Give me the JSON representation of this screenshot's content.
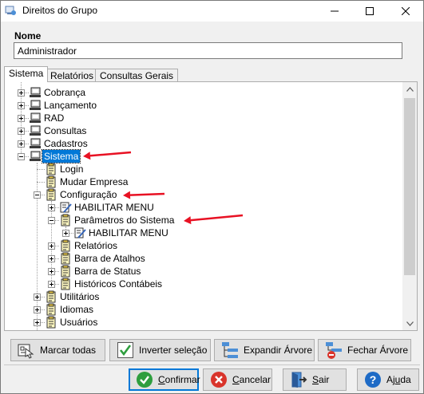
{
  "window": {
    "title": "Direitos do Grupo",
    "app_icon": "group-rights-icon",
    "minimize_icon": "minimize-icon",
    "maximize_icon": "maximize-icon",
    "close_icon": "close-icon"
  },
  "form": {
    "name_label": "Nome",
    "name_value": "Administrador"
  },
  "tabs": [
    {
      "label": "Sistema",
      "active": true
    },
    {
      "label": "Relatórios",
      "active": false
    },
    {
      "label": "Consultas Gerais",
      "active": false
    }
  ],
  "tree": {
    "nodes": [
      {
        "label": "Cobrança",
        "level": 0,
        "expander": "plus",
        "icon": "computer-icon"
      },
      {
        "label": "Lançamento",
        "level": 0,
        "expander": "plus",
        "icon": "computer-icon"
      },
      {
        "label": "RAD",
        "level": 0,
        "expander": "plus",
        "icon": "computer-icon"
      },
      {
        "label": "Consultas",
        "level": 0,
        "expander": "plus",
        "icon": "computer-icon"
      },
      {
        "label": "Cadastros",
        "level": 0,
        "expander": "plus",
        "icon": "computer-icon"
      },
      {
        "label": "Sistema",
        "level": 0,
        "expander": "minus",
        "icon": "computer-icon",
        "selected": true
      },
      {
        "label": "Login",
        "level": 1,
        "expander": "none",
        "icon": "document-icon"
      },
      {
        "label": "Mudar Empresa",
        "level": 1,
        "expander": "none",
        "icon": "document-icon"
      },
      {
        "label": "Configuração",
        "level": 1,
        "expander": "minus",
        "icon": "document-icon"
      },
      {
        "label": "HABILITAR MENU",
        "level": 2,
        "expander": "plus",
        "icon": "edit-icon"
      },
      {
        "label": "Parâmetros do Sistema",
        "level": 2,
        "expander": "minus",
        "icon": "document-icon"
      },
      {
        "label": "HABILITAR MENU",
        "level": 3,
        "expander": "plus",
        "icon": "edit-icon"
      },
      {
        "label": "Relatórios",
        "level": 2,
        "expander": "plus",
        "icon": "document-icon"
      },
      {
        "label": "Barra de Atalhos",
        "level": 2,
        "expander": "plus",
        "icon": "document-icon"
      },
      {
        "label": "Barra de Status",
        "level": 2,
        "expander": "plus",
        "icon": "document-icon"
      },
      {
        "label": "Históricos Contábeis",
        "level": 2,
        "expander": "plus",
        "icon": "document-icon"
      },
      {
        "label": "Utilitários",
        "level": 1,
        "expander": "plus",
        "icon": "document-icon"
      },
      {
        "label": "Idiomas",
        "level": 1,
        "expander": "plus",
        "icon": "document-icon"
      },
      {
        "label": "Usuários",
        "level": 1,
        "expander": "plus",
        "icon": "document-icon"
      }
    ],
    "annotations": [
      "red-arrow-icon",
      "red-arrow-icon",
      "red-arrow-icon"
    ]
  },
  "tree_actions": {
    "select_all": "Marcar todas",
    "invert": "Inverter seleção",
    "expand": "Expandir Árvore",
    "collapse": "Fechar Árvore"
  },
  "dialog_buttons": {
    "confirm": {
      "pre": "",
      "u": "C",
      "post": "onfirmar"
    },
    "cancel": {
      "pre": "",
      "u": "C",
      "post": "ancelar"
    },
    "exit": {
      "pre": "",
      "u": "S",
      "post": "air"
    },
    "help": {
      "pre": "Aj",
      "u": "u",
      "post": "da"
    }
  },
  "colors": {
    "selection": "#0078d7",
    "arrow": "#e81123",
    "confirm_icon": "#2e9e3e",
    "cancel_icon": "#d9342b",
    "help_icon": "#1e6bc6"
  }
}
